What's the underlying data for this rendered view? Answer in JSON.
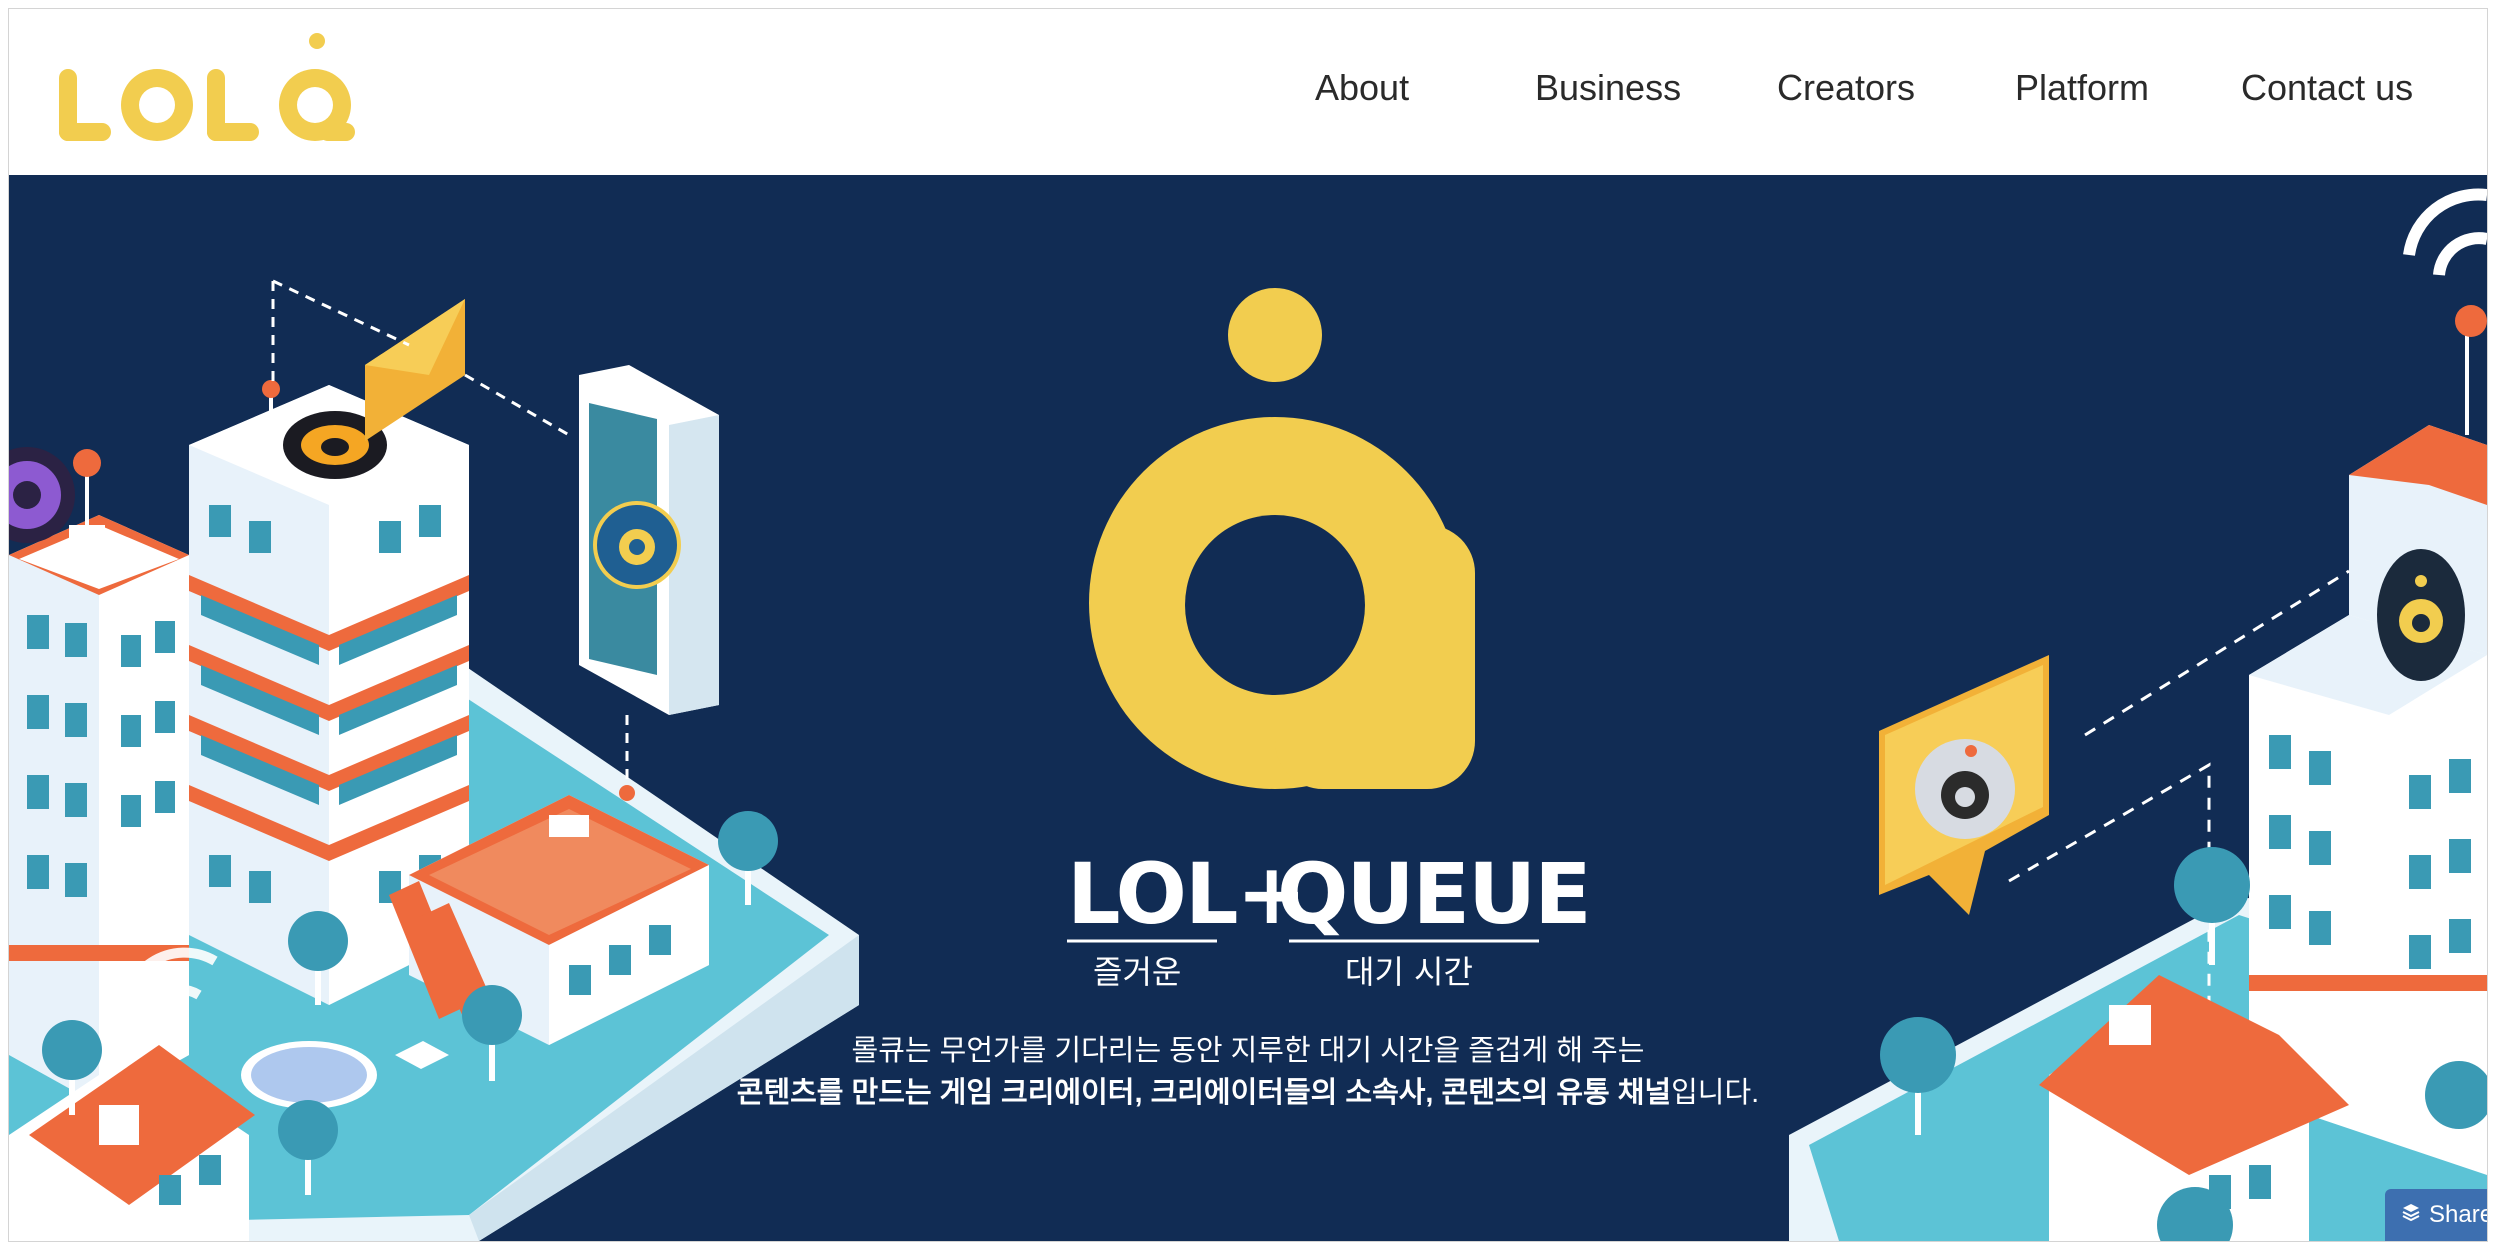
{
  "brand": {
    "logo_text": "LOLQ",
    "logo_color": "#f2cd4f"
  },
  "nav": {
    "items": [
      {
        "label": "About"
      },
      {
        "label": "Business"
      },
      {
        "label": "Creators"
      },
      {
        "label": "Platform"
      },
      {
        "label": "Contact us"
      }
    ]
  },
  "hero": {
    "background": "#112c54",
    "word_lol_plus": "LOL+",
    "word_queue": "QUEUE",
    "caption_lol": "즐거운",
    "caption_queue": "대기 시간",
    "line1": "롤큐는 무언가를 기다리는 동안 지루한 대기 시간을  즐겁게 해 주는",
    "line2_bold": "콘텐츠를 만드는 게임 크리에이터, 크리에이터들의 소속사, 콘텐츠의 유통 채널",
    "line2_regular": "입니다."
  },
  "share_widget": {
    "label": "Share",
    "icon": "layers-icon"
  }
}
